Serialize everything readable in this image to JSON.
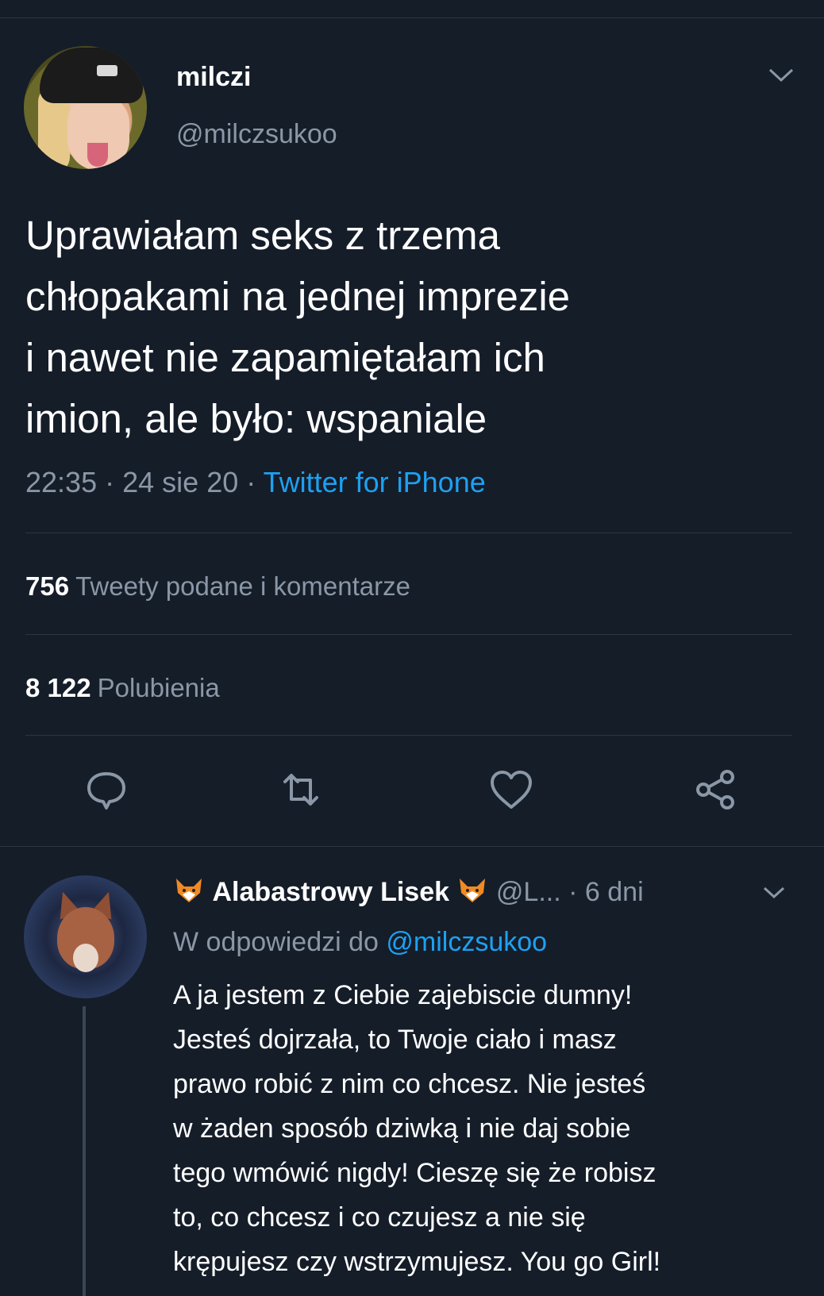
{
  "tweet": {
    "display_name": "milczi",
    "handle": "@milczsukoo",
    "text": "Uprawiałam seks z trzema\nchłopakami na jednej imprezie\ni nawet nie zapamiętałam ich\nimion, ale było: wspaniale",
    "time": "22:35",
    "separator": "·",
    "date": "24 sie 20",
    "source": "Twitter for iPhone",
    "retweets_count": "756",
    "retweets_label": "Tweety podane i komentarze",
    "likes_count": "8 122",
    "likes_label": "Polubienia"
  },
  "actions": {
    "icons": [
      "reply-icon",
      "retweet-icon",
      "like-icon",
      "share-icon"
    ]
  },
  "reply": {
    "display_name": "Alabastrowy Lisek",
    "handle": "@L...",
    "separator": "·",
    "age": "6 dni",
    "reply_prefix": "W odpowiedzi do",
    "reply_mention": "@milczsukoo",
    "text": "A ja jestem z Ciebie zajebiscie dumny!\nJesteś dojrzała, to Twoje ciało i masz\nprawo robić z nim co chcesz. Nie jesteś\nw żaden sposób dziwką i nie daj sobie\ntego wmówić nigdy! Cieszę się że robisz\nto, co chcesz i co czujesz a nie się\nkrępujesz czy wstrzymujesz. You go Girl!"
  },
  "colors": {
    "background": "#151d29",
    "accent": "#1da1f2",
    "muted": "#8a97a6"
  }
}
